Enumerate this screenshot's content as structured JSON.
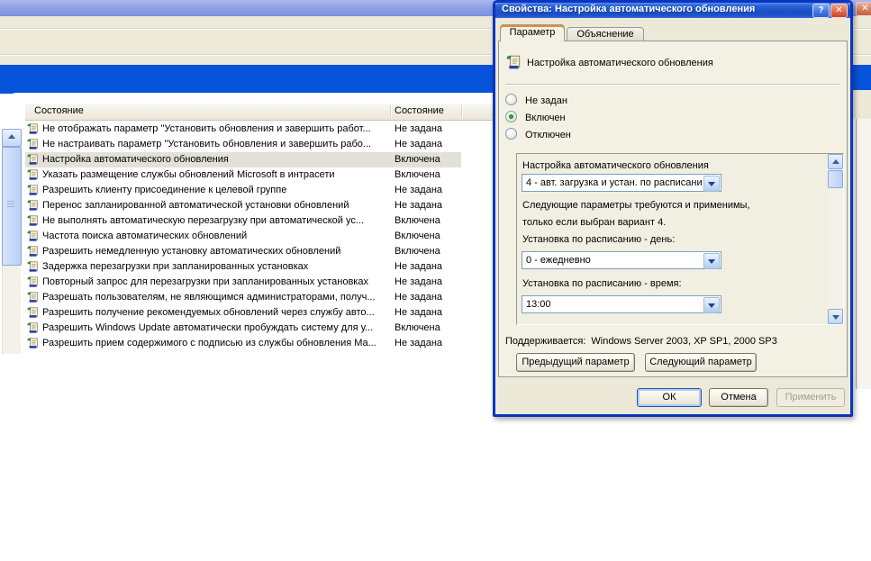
{
  "colors": {
    "active_titlebar": "#1B4FC8",
    "inactive_titlebar": "#8A9EE2",
    "dialog_border": "#0A35C0",
    "highlight_bar": "#0853DC",
    "dialog_background": "#ECE9D8",
    "selected_row": "#E3E1D7"
  },
  "icons": {
    "help": "?",
    "close": "✕"
  },
  "background_window": {
    "list": {
      "header": {
        "col1": "Состояние",
        "col2": "Состояние"
      },
      "rows": [
        {
          "label": "Не отображать параметр \"Установить обновления и завершить работ...",
          "status": "Не задана",
          "selected": false
        },
        {
          "label": "Не настраивать параметр \"Установить обновления и завершить рабо...",
          "status": "Не задана",
          "selected": false
        },
        {
          "label": "Настройка автоматического обновления",
          "status": "Включена",
          "selected": true
        },
        {
          "label": "Указать размещение службы обновлений Microsoft в интрасети",
          "status": "Включена",
          "selected": false
        },
        {
          "label": "Разрешить клиенту присоединение к целевой группе",
          "status": "Не задана",
          "selected": false
        },
        {
          "label": "Перенос запланированной автоматической установки обновлений",
          "status": "Не задана",
          "selected": false
        },
        {
          "label": "Не выполнять автоматическую перезагрузку при автоматической ус...",
          "status": "Включена",
          "selected": false
        },
        {
          "label": "Частота поиска автоматических обновлений",
          "status": "Включена",
          "selected": false
        },
        {
          "label": "Разрешить немедленную установку автоматических обновлений",
          "status": "Включена",
          "selected": false
        },
        {
          "label": "Задержка перезагрузки при запланированных установках",
          "status": "Не задана",
          "selected": false
        },
        {
          "label": "Повторный запрос для перезагрузки при запланированных установках",
          "status": "Не задана",
          "selected": false
        },
        {
          "label": "Разрешать пользователям, не являющимся администраторами, получ...",
          "status": "Не задана",
          "selected": false
        },
        {
          "label": "Разрешить получение рекомендуемых обновлений через службу авто...",
          "status": "Не задана",
          "selected": false
        },
        {
          "label": "Разрешить Windows Update автоматически пробуждать систему для у...",
          "status": "Включена",
          "selected": false
        },
        {
          "label": "Разрешить прием содержимого с подписью из службы обновления Ма...",
          "status": "Не задана",
          "selected": false
        }
      ]
    }
  },
  "dialog": {
    "title": "Свойства: Настройка автоматического обновления",
    "tabs": [
      {
        "label": "Параметр"
      },
      {
        "label": "Объяснение"
      }
    ],
    "policy_header": "Настройка автоматического обновления",
    "radios": [
      {
        "label": "Не задан",
        "selected": false
      },
      {
        "label": "Включен",
        "selected": true
      },
      {
        "label": "Отключен",
        "selected": false
      }
    ],
    "settings": {
      "group_label": "Настройка автоматического обновления",
      "mode_value": "4 - авт. загрузка и устан. по расписани",
      "note_line1": "Следующие параметры требуются и применимы,",
      "note_line2": "только если выбран вариант 4.",
      "day_label": "Установка по расписанию - день:",
      "day_value": "0 - ежедневно",
      "time_label": "Установка по расписанию - время:",
      "time_value": "13:00"
    },
    "supported_label": "Поддерживается:",
    "supported_value": "Windows Server 2003, XP SP1, 2000 SP3",
    "buttons": {
      "previous": "Предыдущий параметр",
      "next": "Следующий параметр",
      "ok": "ОК",
      "cancel": "Отмена",
      "apply": "Применить"
    }
  }
}
